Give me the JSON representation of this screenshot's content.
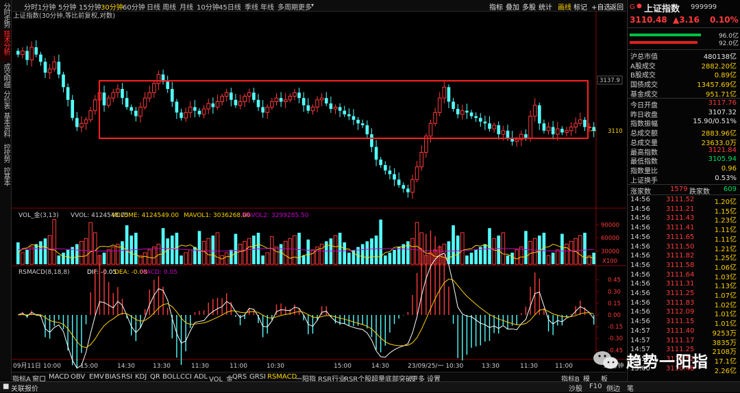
{
  "left_tabs": [
    "分时走势",
    "技术分析",
    "成交明细",
    "分价表",
    "基本资料",
    "控优势",
    "控基本"
  ],
  "toolbar": {
    "periods": [
      "分时",
      "1分钟",
      "5分钟",
      "15分钟",
      "30分钟",
      "60分钟",
      "日线",
      "周线",
      "月线",
      "10分钟",
      "45日线",
      "季线",
      "年线",
      "多周期",
      "更多"
    ],
    "active_period": "30分钟",
    "right": [
      "指标",
      "叠加",
      "多股",
      "统计",
      "画线",
      "标记",
      "+自选",
      "返回"
    ]
  },
  "chart": {
    "title": "上证指数(30分钟,等比前复权,对数)",
    "price_labels": {
      "top": "3137.9",
      "mid": "3110"
    },
    "vol_header": {
      "name": "VOL_金(3,13)",
      "vvol": "VVOL: 4124548.75",
      "volume": "VOLUME: 4124549.00",
      "mavol1": "MAVOL1: 3036268.00",
      "mavol2": "MAVOL2: 3299285.50"
    },
    "vol_ticks": [
      "90000",
      "60000",
      "30000"
    ],
    "vol_unit": "X100",
    "macd_header": {
      "name": "RSMACD(8,18,8)",
      "dif": "DIF: -0.05",
      "dea": "DEA: -0.08",
      "macd": "MACD: 0.05"
    },
    "macd_ticks": [
      "0.45",
      "0.30",
      "0.15",
      "0.00",
      "-0.15",
      "-0.30",
      "-0.45"
    ],
    "time_axis": [
      "09月11日",
      "10:00",
      "15:00",
      "14:30",
      "13:30",
      "11:30",
      "11:00",
      "10:30",
      "15:00",
      "14:30",
      "23/09/25/一 10:30",
      "13:30",
      "11:30",
      "11:00"
    ],
    "time_axis_right": "30分钟",
    "colors": {
      "up": "#ff3b3b",
      "down": "#54ffff",
      "box": "#ff2020",
      "dif": "#ffffff",
      "dea": "#ffd200",
      "mavol2": "#c800c8"
    }
  },
  "chart_data": {
    "type": "candlestick",
    "title": "上证指数(30分钟,等比前复权,对数)",
    "ylabel_ticks": [
      "3137.9",
      "3110"
    ],
    "closes": [
      3152,
      3154,
      3149,
      3156,
      3152,
      3148,
      3142,
      3144,
      3148,
      3141,
      3134,
      3127,
      3117,
      3112,
      3114,
      3116,
      3121,
      3127,
      3131,
      3124,
      3128,
      3131,
      3133,
      3128,
      3123,
      3121,
      3118,
      3123,
      3128,
      3131,
      3136,
      3141,
      3137,
      3133,
      3126,
      3120,
      3117,
      3120,
      3123,
      3121,
      3119,
      3122,
      3125,
      3123,
      3126,
      3129,
      3131,
      3127,
      3124,
      3126,
      3129,
      3131,
      3127,
      3123,
      3120,
      3123,
      3126,
      3128,
      3126,
      3127,
      3129,
      3131,
      3128,
      3124,
      3121,
      3123,
      3127,
      3128,
      3125,
      3122,
      3123,
      3121,
      3119,
      3118,
      3116,
      3114,
      3113,
      3108,
      3101,
      3094,
      3091,
      3088,
      3086,
      3083,
      3080,
      3078,
      3076,
      3083,
      3090,
      3098,
      3107,
      3114,
      3120,
      3128,
      3134,
      3126,
      3122,
      3119,
      3121,
      3120,
      3118,
      3117,
      3115,
      3114,
      3111,
      3113,
      3108,
      3110,
      3106,
      3104,
      3105,
      3108,
      3106,
      3118,
      3124,
      3114,
      3110,
      3112,
      3108,
      3111,
      3109,
      3110,
      3112,
      3114,
      3116,
      3112,
      3112,
      3110
    ],
    "volume_ticks": [
      90000,
      60000,
      30000
    ],
    "macd_range": [
      -0.45,
      0.45
    ],
    "dif": -0.05,
    "dea": -0.08,
    "macd": 0.05
  },
  "bottom_tabs": {
    "items": [
      "指标A",
      "窗口",
      "MACD",
      "OBV",
      "EMV",
      "BIAS",
      "RSI",
      "KDJ",
      "QR",
      "BOLL",
      "CCI",
      "ADL",
      "VOL_金",
      "QRS",
      "GRSI",
      "RSMACD",
      "一阳指",
      "RSR行业",
      "RSR个股",
      "超量底部突破",
      "更多",
      "设置"
    ],
    "active": "RSMACD",
    "right": [
      "指标B",
      "模",
      "板"
    ]
  },
  "status": {
    "left": "关联报价",
    "right": [
      "沙股",
      "F10",
      "侧边",
      "笔"
    ]
  },
  "panel": {
    "code_letter": "G",
    "name": "上证指数",
    "code": "999999",
    "price": "3110.48",
    "change": "▲3.16",
    "change_pct": "0.10%",
    "bars": [
      {
        "pct": "96.0亿",
        "color": "#00c040",
        "fill": 0.96
      },
      {
        "pct": "92.0亿",
        "color": "#e02020",
        "fill": 0.92
      }
    ],
    "stats1": [
      {
        "k": "沪总市值",
        "v": "480138亿",
        "c": "white"
      },
      {
        "k": "A股成交",
        "v": "2882.20亿",
        "c": "yellow"
      },
      {
        "k": "B股成交",
        "v": "0.89亿",
        "c": "yellow"
      },
      {
        "k": "国债成交",
        "v": "13457.69亿",
        "c": "yellow"
      },
      {
        "k": "基金成交",
        "v": "951.71亿",
        "c": "yellow"
      }
    ],
    "stats2": [
      {
        "k": "今日开盘",
        "v": "3117.76",
        "c": "red"
      },
      {
        "k": "昨日收盘",
        "v": "3107.32",
        "c": "white"
      },
      {
        "k": "指数振幅",
        "v": "15.90/0.51%",
        "c": "white"
      },
      {
        "k": "总成交额",
        "v": "2883.96亿",
        "c": "yellow"
      },
      {
        "k": "总成交量",
        "v": "23633.0万",
        "c": "yellow"
      },
      {
        "k": "最高指数",
        "v": "3121.84",
        "c": "red"
      },
      {
        "k": "最低指数",
        "v": "3105.94",
        "c": "green"
      },
      {
        "k": "指数量比",
        "v": "0.96",
        "c": "yellow"
      },
      {
        "k": "上证换手",
        "v": "0.53%",
        "c": "white"
      }
    ],
    "updown": {
      "up_label": "涨家数",
      "up": "1579",
      "down_label": "跌家数",
      "down": "609"
    },
    "ticks": [
      [
        "14:56",
        "3111.52",
        "1.20亿"
      ],
      [
        "14:56",
        "3111.21",
        "1.15亿"
      ],
      [
        "14:56",
        "3111.43",
        "1.23亿"
      ],
      [
        "14:56",
        "3111.41",
        "1.11亿"
      ],
      [
        "14:56",
        "3111.65",
        "1.11亿"
      ],
      [
        "14:56",
        "3111.50",
        "1.21亿"
      ],
      [
        "14:56",
        "3111.82",
        "1.25亿"
      ],
      [
        "14:56",
        "3111.58",
        "1.06亿"
      ],
      [
        "14:56",
        "3111.64",
        "1.03亿"
      ],
      [
        "14:56",
        "3111.31",
        "1.13亿"
      ],
      [
        "14:56",
        "3111.25",
        "1.07亿"
      ],
      [
        "14:56",
        "3111.83",
        "1.02亿"
      ],
      [
        "14:56",
        "3112.09",
        "1.01亿"
      ],
      [
        "14:56",
        "3111.15",
        "1.01亿"
      ],
      [
        "14:57",
        "3111.40",
        "9253万"
      ],
      [
        "14:57",
        "3111.17",
        "3835万"
      ],
      [
        "14:57",
        "3111.25",
        "2108万"
      ],
      [
        "14:57",
        "3111.52",
        "17.1亿"
      ],
      [
        "15:00",
        "3110.48",
        "2.26亿"
      ]
    ]
  },
  "watermark": "趋势一阳指"
}
